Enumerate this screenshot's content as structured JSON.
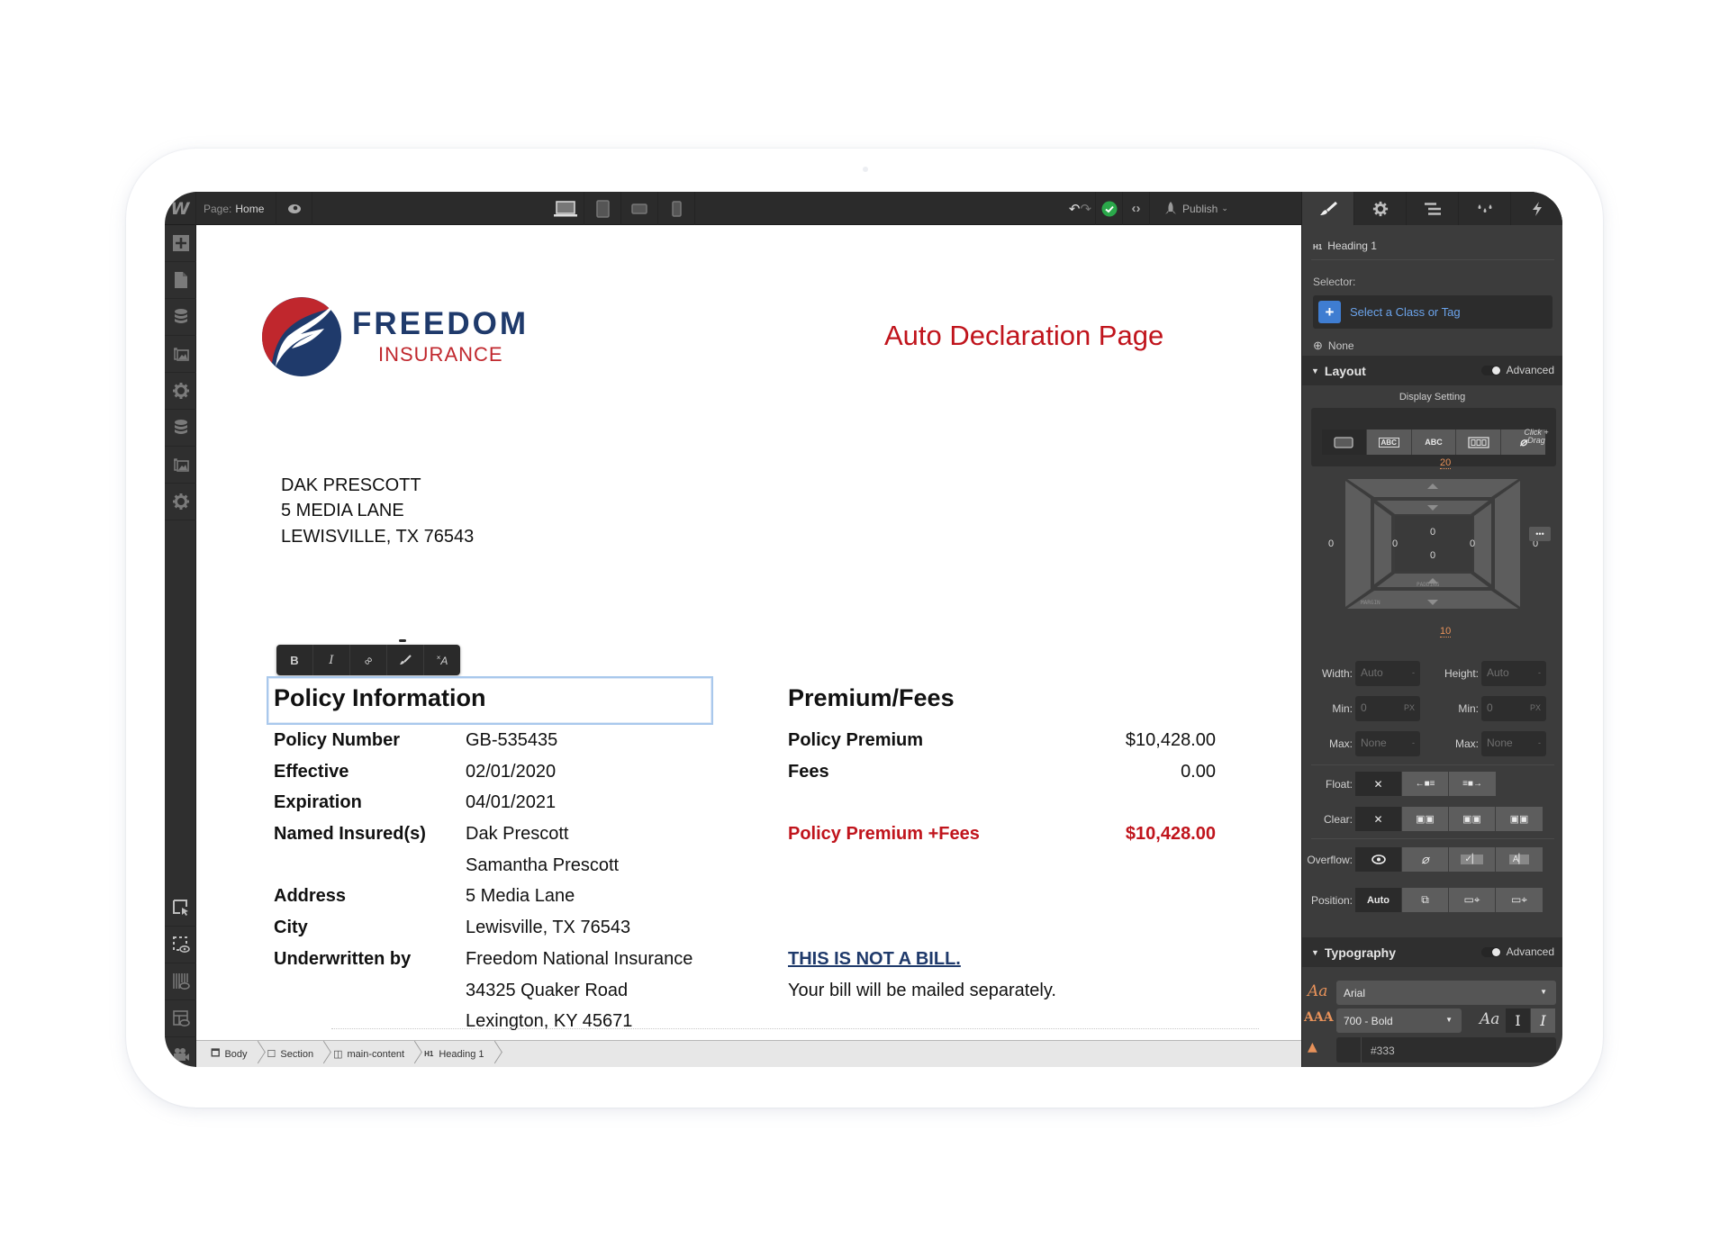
{
  "app": {
    "logo": "W",
    "page_key": "Page:",
    "page_value": "Home",
    "publish_label": "Publish",
    "status_color": "#2aa84a"
  },
  "document": {
    "brand_name": "FREEDOM",
    "brand_sub": "INSURANCE",
    "title": "Auto Declaration Page",
    "mailing_address": [
      "DAK PRESCOTT",
      "5 MEDIA LANE",
      "LEWISVILLE, TX 76543"
    ],
    "format_toolbar": [
      "B",
      "I",
      "link",
      "brush",
      "clear-format"
    ],
    "policy_heading": "Policy Information",
    "policy_rows": [
      {
        "label": "Policy Number",
        "value": "GB-535435"
      },
      {
        "label": "Effective",
        "value": "02/01/2020"
      },
      {
        "label": "Expiration",
        "value": "04/01/2021"
      },
      {
        "label": "Named Insured(s)",
        "value": "Dak Prescott"
      },
      {
        "label": "",
        "value": "Samantha Prescott"
      },
      {
        "label": "Address",
        "value": "5 Media Lane"
      },
      {
        "label": "City",
        "value": "Lewisville, TX 76543"
      },
      {
        "label": "Underwritten by",
        "value": "Freedom National Insurance"
      },
      {
        "label": "",
        "value": "34325 Quaker Road"
      },
      {
        "label": "",
        "value": "Lexington, KY 45671"
      }
    ],
    "premium_heading": "Premium/Fees",
    "premium_rows": [
      {
        "label": "Policy Premium",
        "value": "$10,428.00"
      },
      {
        "label": "Fees",
        "value": "0.00"
      }
    ],
    "total": {
      "label": "Policy Premium +Fees",
      "value": "$10,428.00"
    },
    "not_bill": "THIS IS NOT A BILL.",
    "bill_note": "Your bill will be mailed separately.",
    "colors": {
      "brand_blue": "#1f3a6b",
      "brand_red": "#c0141c"
    }
  },
  "breadcrumb": [
    {
      "icon": "body-icon",
      "label": "Body"
    },
    {
      "icon": "section-icon",
      "label": "Section"
    },
    {
      "icon": "div-icon",
      "label": "main-content"
    },
    {
      "icon": "h1-tag",
      "tag": "H1",
      "label": "Heading 1"
    }
  ],
  "panel": {
    "element_tag": "H1",
    "element_name": "Heading 1",
    "selector_label": "Selector:",
    "selector_placeholder": "Select a Class or Tag",
    "selector_state": "None",
    "layout": {
      "title": "Layout",
      "advanced": "Advanced",
      "display_setting": "Display Setting",
      "display_options": [
        "block",
        "inline-block",
        "inline",
        "flex",
        "none"
      ],
      "display_active": "block",
      "margin_top": "20",
      "margin_bottom": "10",
      "margin_left": "0",
      "margin_right": "0",
      "padding_top": "0",
      "padding_bottom": "0",
      "padding_left": "0",
      "padding_right": "0",
      "margin_label": "MARGIN",
      "padding_label": "PADDING",
      "hint": "Click + Drag",
      "width_label": "Width:",
      "width_value": "Auto",
      "height_label": "Height:",
      "height_value": "Auto",
      "min_label": "Min:",
      "min_w": "0",
      "min_h": "0",
      "unit": "PX",
      "max_label": "Max:",
      "max_w": "None",
      "max_h": "None",
      "float_label": "Float:",
      "clear_label": "Clear:",
      "overflow_label": "Overflow:",
      "position_label": "Position:",
      "position_value": "Auto"
    },
    "typography": {
      "title": "Typography",
      "advanced": "Advanced",
      "font": "Arial",
      "weight": "700 - Bold",
      "color": "#333"
    }
  }
}
